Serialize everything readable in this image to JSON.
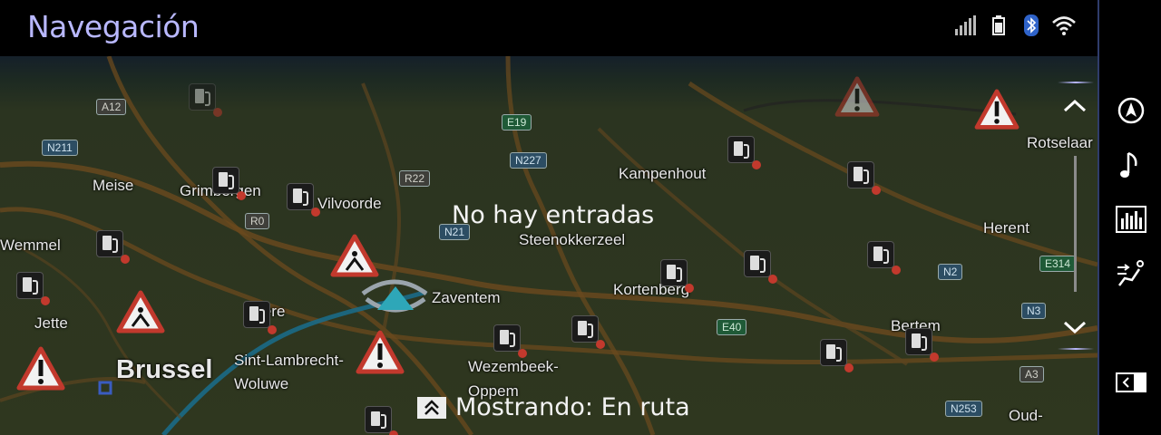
{
  "header": {
    "title": "Navegación"
  },
  "status_icons": [
    "signal-icon",
    "battery-icon",
    "bluetooth-icon",
    "wifi-icon"
  ],
  "main": {
    "empty_message": "No hay entradas",
    "showing_label": "Mostrando: En ruta"
  },
  "map": {
    "places": [
      {
        "name": "Meise"
      },
      {
        "name": "Grimbergen"
      },
      {
        "name": "Vilvoorde"
      },
      {
        "name": "Kampenhout"
      },
      {
        "name": "Steenokkerzeel"
      },
      {
        "name": "Wemmel"
      },
      {
        "name": "Zaventem"
      },
      {
        "name": "Kortenberg"
      },
      {
        "name": "Herent"
      },
      {
        "name": "Rotselaar"
      },
      {
        "name": "Jette"
      },
      {
        "name": "Evere"
      },
      {
        "name": "Brussel"
      },
      {
        "name": "Sint-Lambrecht-"
      },
      {
        "name": "Woluwe"
      },
      {
        "name": "Wezembeek-"
      },
      {
        "name": "Oppem"
      },
      {
        "name": "Bertem"
      },
      {
        "name": "Oud-"
      }
    ],
    "road_labels": [
      "A12",
      "N211",
      "E19",
      "N227",
      "R22",
      "R0",
      "N21",
      "E40",
      "N2",
      "E314",
      "N3",
      "A3",
      "N253"
    ]
  },
  "sidebar": {
    "items": [
      {
        "icon": "compass-icon"
      },
      {
        "icon": "music-note-icon"
      },
      {
        "icon": "equalizer-icon"
      },
      {
        "icon": "seat-climate-icon"
      },
      {
        "icon": "split-screen-icon"
      }
    ]
  },
  "colors": {
    "accent": "#b9b8ff",
    "sidebar_border": "#2f3c6b",
    "road": "#6b4a1e",
    "highway_blue": "#1b6a86"
  }
}
